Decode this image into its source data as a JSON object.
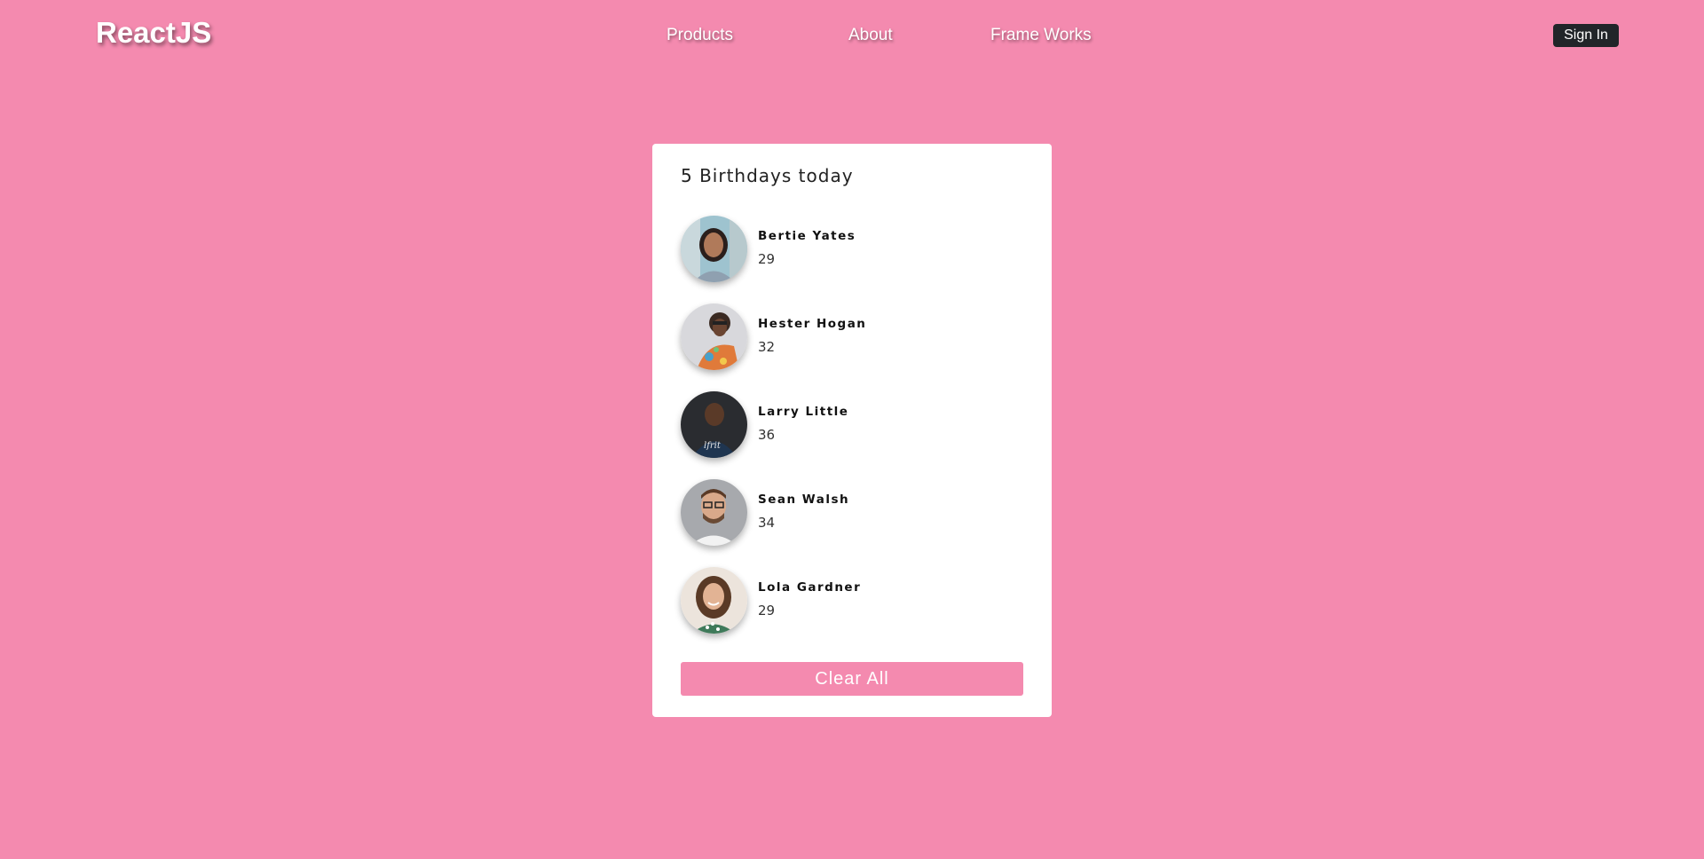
{
  "navbar": {
    "brand": "ReactJS",
    "links": [
      "Products",
      "About",
      "Frame Works"
    ],
    "signin_label": "Sign In"
  },
  "birthdays": {
    "title": "5 Birthdays today",
    "people": [
      {
        "name": "Bertie Yates",
        "age": "29"
      },
      {
        "name": "Hester Hogan",
        "age": "32"
      },
      {
        "name": "Larry Little",
        "age": "36"
      },
      {
        "name": "Sean Walsh",
        "age": "34"
      },
      {
        "name": "Lola Gardner",
        "age": "29"
      }
    ],
    "clear_label": "Clear All"
  },
  "colors": {
    "background": "#f48aaf",
    "card": "#ffffff",
    "signin_button": "#212529",
    "clear_button": "#f48aaf"
  }
}
